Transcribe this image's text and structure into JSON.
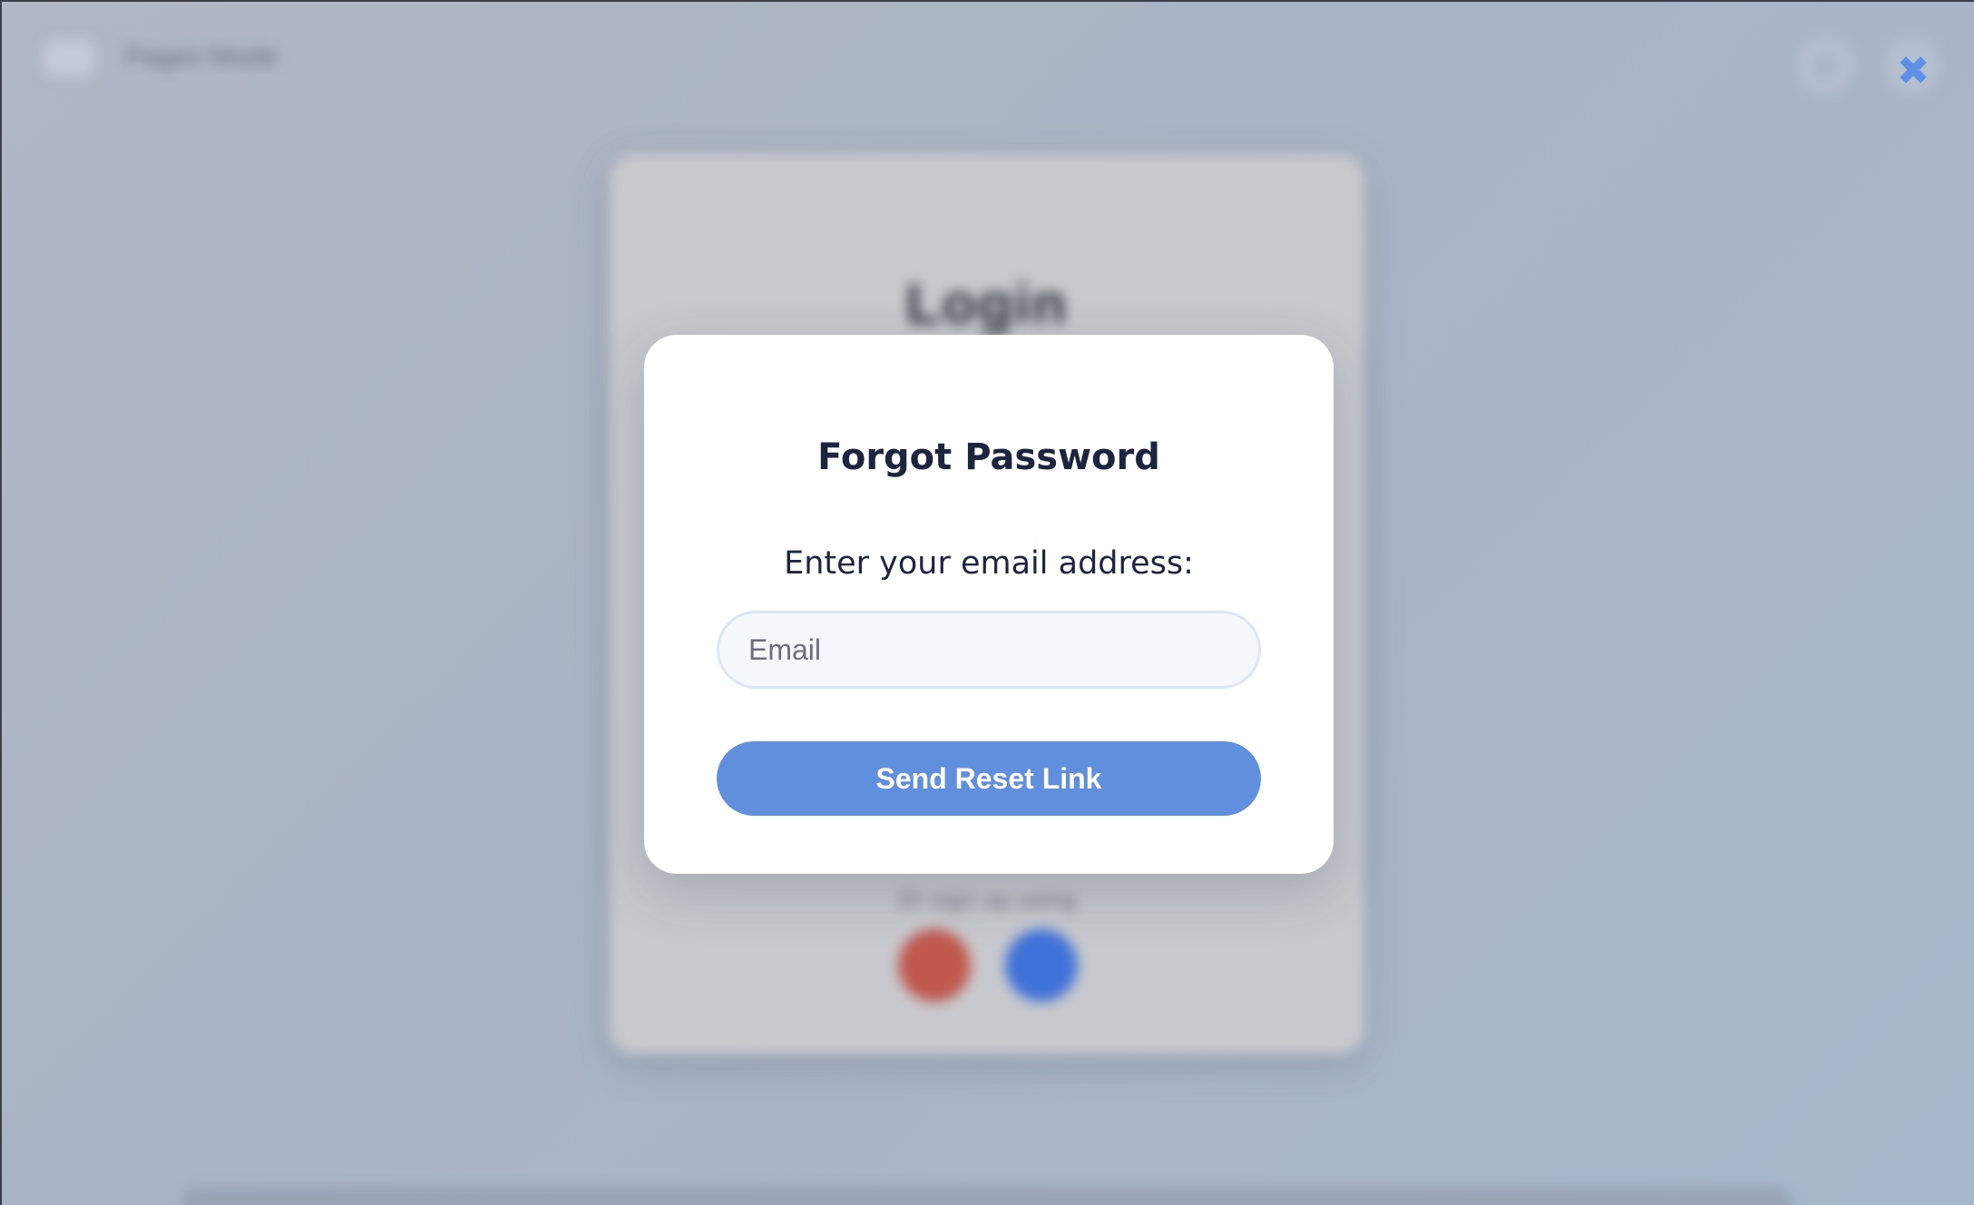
{
  "background": {
    "app_title": "Pages Mode",
    "info_icon": "info-icon",
    "close_icon": "close-icon",
    "login_card": {
      "title": "Login",
      "signup_text": "Or sign up using",
      "social_buttons": [
        {
          "name": "google-icon",
          "color": "#c0584d"
        },
        {
          "name": "facebook-icon",
          "color": "#3f72d8"
        }
      ]
    }
  },
  "close_button": {
    "glyph": "✖",
    "color": "#5f8fe6"
  },
  "modal": {
    "title": "Forgot Password",
    "prompt": "Enter your email address:",
    "email_input": {
      "value": "",
      "placeholder": "Email"
    },
    "submit_label": "Send Reset Link",
    "accent_color": "#5f8fdd",
    "title_color": "#1c2440"
  }
}
